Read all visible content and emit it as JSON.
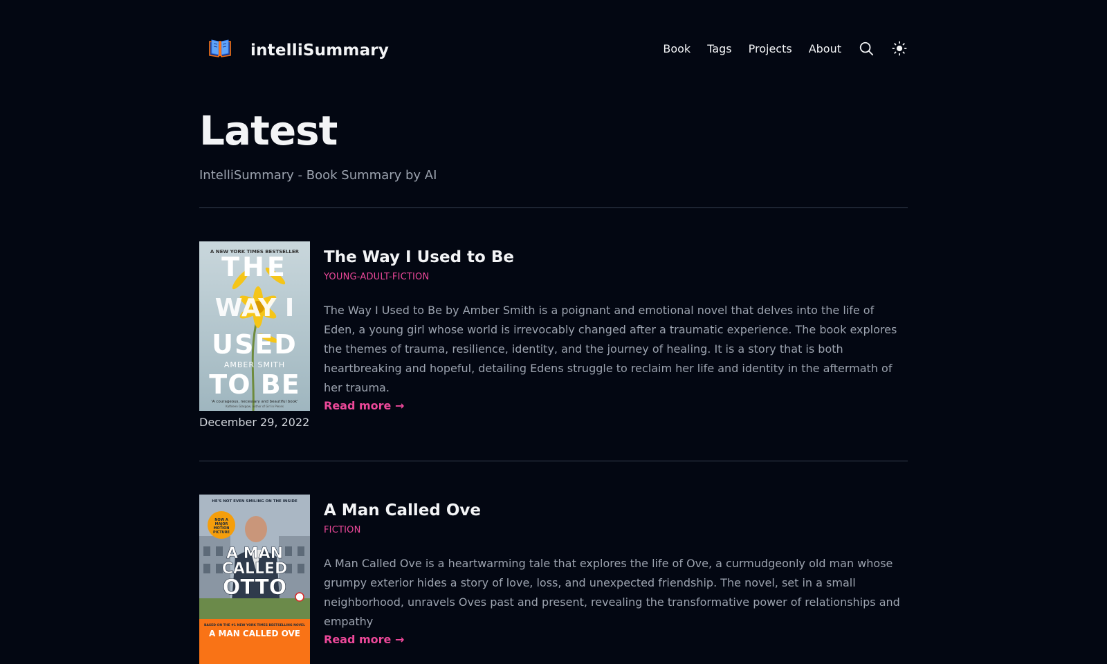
{
  "header": {
    "site_title": "intelliSummary",
    "nav": [
      {
        "label": "Book"
      },
      {
        "label": "Tags"
      },
      {
        "label": "Projects"
      },
      {
        "label": "About"
      }
    ],
    "search_icon": "search-icon",
    "theme_icon": "sun-icon"
  },
  "hero": {
    "title": "Latest",
    "subtitle": "IntelliSummary - Book Summary by AI"
  },
  "posts": [
    {
      "title": "The Way I Used to Be",
      "tag": "YOUNG-ADULT-FICTION",
      "summary": "The Way I Used to Be by Amber Smith is a poignant and emotional novel that delves into the life of Eden, a young girl whose world is irrevocably changed after a traumatic experience. The book explores the themes of trauma, resilience, identity, and the journey of healing. It is a story that is both heartbreaking and hopeful, detailing Edens struggle to reclaim her life and identity in the aftermath of her trauma.",
      "read_more": "Read more →",
      "date": "December 29, 2022",
      "cover": {
        "top_line": "A NEW YORK TIMES BESTSELLER",
        "title_lines": [
          "THE",
          "WAY I",
          "USED",
          "TO BE"
        ],
        "author": "AMBER SMITH",
        "quote": "'A courageous, necessary and beautiful book'",
        "quote_attrib": "Kathleen Glasgow, author of Girl in Pieces"
      }
    },
    {
      "title": "A Man Called Ove",
      "tag": "FICTION",
      "summary": "A Man Called Ove is a heartwarming tale that explores the life of Ove, a curmudgeonly old man whose grumpy exterior hides a story of love, loss, and unexpected friendship. The novel, set in a small neighborhood, unravels Oves past and present, revealing the transformative power of relationships and empathy",
      "read_more": "Read more →",
      "cover": {
        "top_line": "HE'S NOT EVEN SMILING ON THE INSIDE",
        "badge_small": "NOW A",
        "badge": "MAJOR MOTION PICTURE",
        "title_lines": [
          "A MAN",
          "CALLED",
          "OTTO"
        ],
        "bottom_line": "BASED ON THE #1 NEW YORK TIMES BESTSELLING NOVEL",
        "bottom_title": "A MAN CALLED OVE"
      }
    }
  ],
  "colors": {
    "background": "#030712",
    "accent": "#ec4899",
    "text": "#f3f4f6",
    "muted": "#9ca3af",
    "divider": "#374151"
  }
}
